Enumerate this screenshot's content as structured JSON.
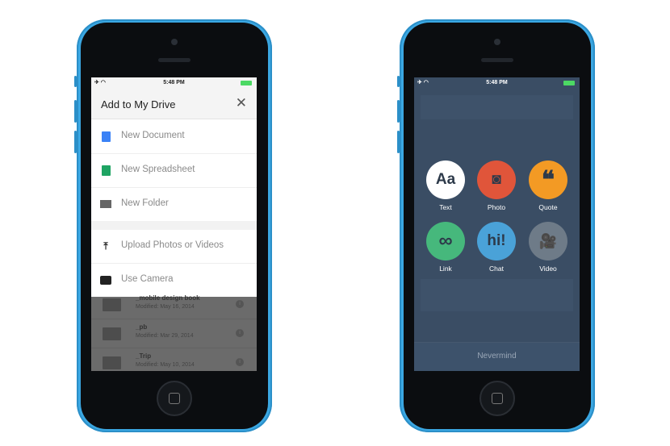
{
  "status_bar": {
    "time": "5:48 PM"
  },
  "left_phone": {
    "title": "Add to My Drive",
    "close_icon": "close-icon",
    "menu": [
      {
        "label": "New Document",
        "icon": "doc-icon",
        "color": "#3b82f6"
      },
      {
        "label": "New Spreadsheet",
        "icon": "sheet-icon",
        "color": "#1fa463"
      },
      {
        "label": "New Folder",
        "icon": "folder-icon"
      },
      {
        "label": "Upload Photos or Videos",
        "icon": "upload-icon"
      },
      {
        "label": "Use Camera",
        "icon": "camera-icon"
      }
    ],
    "files": [
      {
        "name": "_mobile design book",
        "modified": "Modified: May 16, 2014"
      },
      {
        "name": "_pb",
        "modified": "Modified: Mar 29, 2014"
      },
      {
        "name": "_Trip",
        "modified": "Modified: May 10, 2014"
      }
    ]
  },
  "right_phone": {
    "options": [
      {
        "label": "Text",
        "glyph": "Aa",
        "color": "#ffffff"
      },
      {
        "label": "Photo",
        "glyph": "◙",
        "color": "#e0553a"
      },
      {
        "label": "Quote",
        "glyph": "❝",
        "color": "#f39a24"
      },
      {
        "label": "Link",
        "glyph": "∞",
        "color": "#46b87c"
      },
      {
        "label": "Chat",
        "glyph": "hi!",
        "color": "#4aa2d8"
      },
      {
        "label": "Video",
        "glyph": "🎥",
        "color": "#6e7b88"
      }
    ],
    "dismiss_label": "Nevermind"
  }
}
